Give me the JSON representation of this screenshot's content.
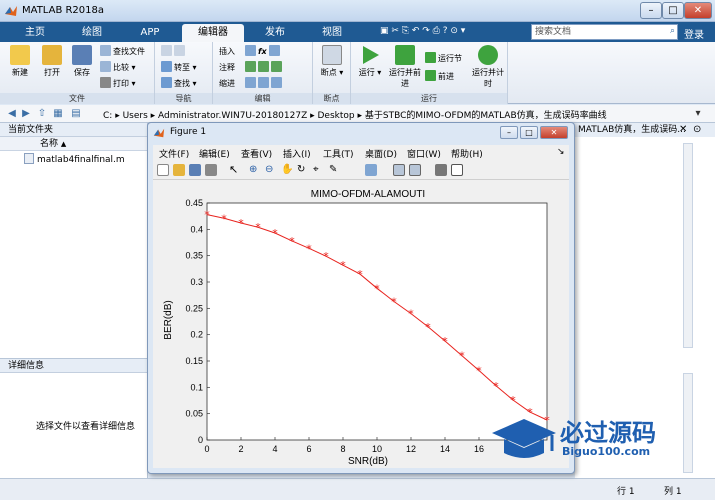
{
  "window": {
    "title": "MATLAB R2018a"
  },
  "ribbon": {
    "tabs": [
      "主页",
      "绘图",
      "APP",
      "编辑器",
      "发布",
      "视图"
    ],
    "search_placeholder": "搜索文档",
    "login": "登录"
  },
  "toolstrip": {
    "file": {
      "label": "文件",
      "new": "新建",
      "open": "打开",
      "save": "保存",
      "find_file": "查找文件",
      "compare": "比较",
      "print": "打印"
    },
    "nav": {
      "label": "导航",
      "goto": "转至",
      "find": "查找"
    },
    "edit": {
      "label": "编辑",
      "insert": "插入",
      "comment": "注释",
      "indent": "缩进",
      "fx": "fx"
    },
    "breakpoint": {
      "label": "断点",
      "bp": "断点"
    },
    "run": {
      "label": "运行",
      "run": "运行",
      "run_advance": "运行并前进",
      "run_section": "运行节",
      "advance": "前进",
      "run_time": "运行并计时"
    }
  },
  "address": {
    "c": "C:",
    "users": "Users",
    "admin": "Administrator.WIN7U-20180127Z",
    "desktop": "Desktop",
    "folder": "基于STBC的MIMO-OFDM的MATLAB仿真，生成误码率曲线"
  },
  "left_panel": {
    "title": "当前文件夹",
    "col": "名称",
    "sort": "▲",
    "file": "matlab4finalfinal.m"
  },
  "details": {
    "title": "详细信息",
    "text": "选择文件以查看详细信息"
  },
  "right_panel": {
    "title": "MATLAB仿真，生成误码..."
  },
  "status": {
    "row": "行 1",
    "col": "列 1"
  },
  "figure": {
    "title": "Figure 1",
    "menus": [
      "文件(F)",
      "编辑(E)",
      "查看(V)",
      "插入(I)",
      "工具(T)",
      "桌面(D)",
      "窗口(W)",
      "帮助(H)"
    ]
  },
  "watermark": {
    "cn": "必过源码",
    "en": "Biguo100.com"
  },
  "chart_data": {
    "type": "line",
    "title": "MIMO-OFDM-ALAMOUTI",
    "xlabel": "SNR(dB)",
    "ylabel": "BER(dB)",
    "xlim": [
      0,
      20
    ],
    "ylim": [
      0,
      0.45
    ],
    "xticks": [
      "0",
      "2",
      "4",
      "6",
      "8",
      "10",
      "12",
      "14",
      "16",
      "18"
    ],
    "yticks": [
      "0",
      "0.05",
      "0.1",
      "0.15",
      "0.2",
      "0.25",
      "0.3",
      "0.35",
      "0.4",
      "0.45"
    ],
    "series": [
      {
        "color": "#e8231e",
        "marker": "*",
        "x": [
          0,
          1,
          2,
          3,
          4,
          5,
          6,
          7,
          8,
          9,
          10,
          11,
          12,
          13,
          14,
          15,
          16,
          17,
          18,
          19,
          20
        ],
        "values": [
          0.428,
          0.421,
          0.412,
          0.404,
          0.393,
          0.378,
          0.364,
          0.349,
          0.332,
          0.315,
          0.288,
          0.263,
          0.24,
          0.215,
          0.188,
          0.16,
          0.132,
          0.103,
          0.076,
          0.053,
          0.038
        ]
      }
    ]
  }
}
